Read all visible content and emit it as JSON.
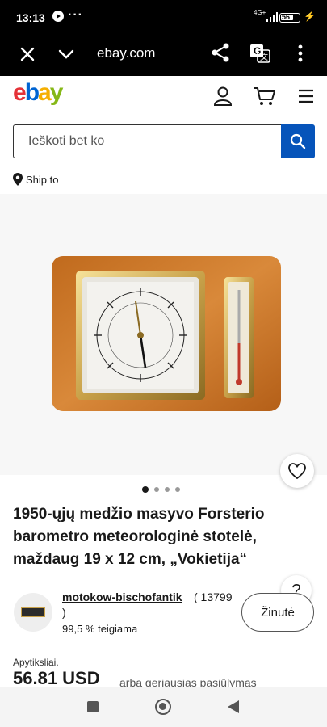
{
  "status": {
    "time": "13:13",
    "net": "4G+",
    "battery": "56"
  },
  "browser": {
    "url": "ebay.com"
  },
  "header": {
    "logo": {
      "e": "e",
      "b": "b",
      "a": "a",
      "y": "y"
    }
  },
  "search": {
    "placeholder": "Ieškoti bet ko"
  },
  "ship_to": "Ship to",
  "gallery": {
    "image_count": 4,
    "active_index": 1
  },
  "listing": {
    "title": "1950-ųjų medžio masyvo Forsterio barometro meteorologinė stotelė, maždaug 19 x 12 cm, „Vokietija“"
  },
  "seller": {
    "name": "motokow-bischofantik",
    "count": "( 13799",
    "paren": ")",
    "rating": "99,5 % teigiama",
    "follow_label": "Žinutė"
  },
  "price": {
    "approx_label": "Apytiksliai.",
    "value": "56.81 USD",
    "offer": "arba geriausias pasiūlymas"
  },
  "help_label": "?",
  "colors": {
    "accent": "#0654ba",
    "ebay_e": "#e53238",
    "ebay_b": "#0064d2",
    "ebay_a": "#f5af02",
    "ebay_y": "#86b817"
  }
}
